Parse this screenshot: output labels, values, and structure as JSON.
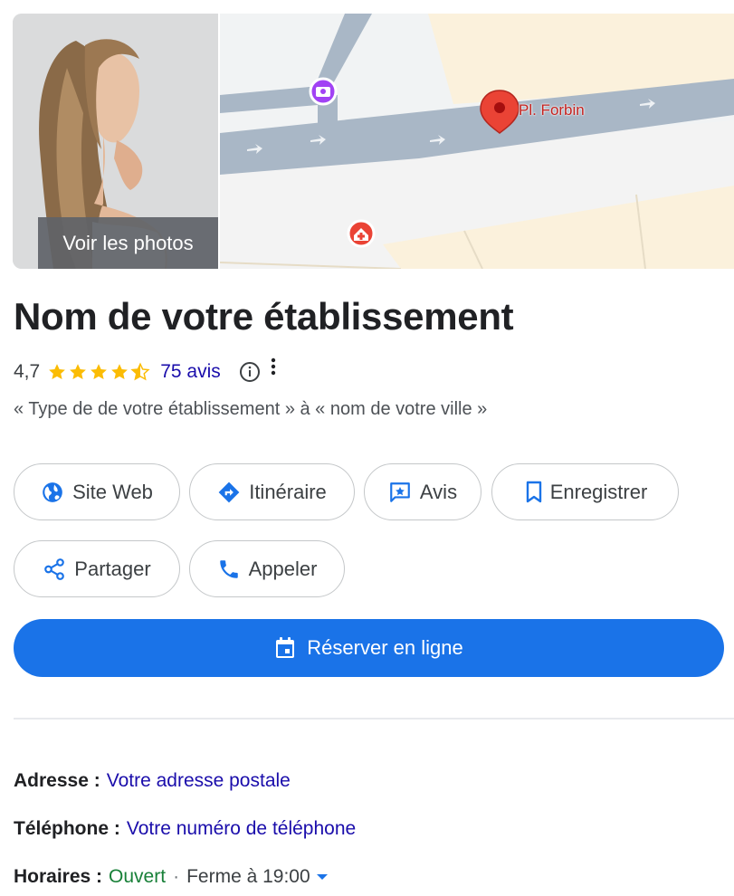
{
  "photo": {
    "button_label": "Voir les photos"
  },
  "map": {
    "place_label": "Pl. Forbin",
    "pin_color": "#ea4335"
  },
  "business": {
    "name": "Nom de votre établissement",
    "rating": "4,7",
    "stars": 4.7,
    "reviews": "75 avis",
    "category": "« Type de de votre établissement » à « nom de votre ville »"
  },
  "actions": {
    "website": "Site Web",
    "directions": "Itinéraire",
    "reviews": "Avis",
    "save": "Enregistrer",
    "share": "Partager",
    "call": "Appeler",
    "book": "Réserver en ligne"
  },
  "info": {
    "address_label": "Adresse :",
    "address_value": "Votre adresse postale",
    "phone_label": "Téléphone :",
    "phone_value": "Votre numéro de téléphone",
    "hours_label": "Horaires :",
    "hours_status": "Ouvert",
    "hours_separator": "·",
    "hours_close": "Ferme à 19:00"
  },
  "colors": {
    "accent": "#1a73e8",
    "link": "#1a0dab",
    "open": "#188038",
    "star": "#fbbc04"
  }
}
